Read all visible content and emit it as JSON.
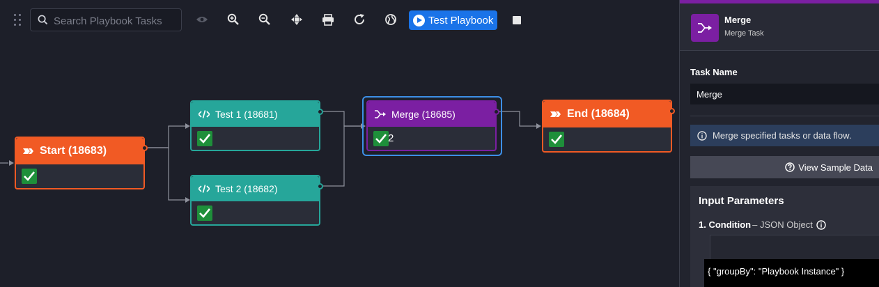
{
  "toolbar": {
    "search_placeholder": "Search Playbook Tasks",
    "icons": [
      "drag-handle-icon",
      "eye-icon",
      "zoom-in-icon",
      "zoom-out-icon",
      "fit-to-screen-icon",
      "print-icon",
      "refresh-icon",
      "globe-icon",
      "stop-icon"
    ],
    "test_button_label": "Test Playbook"
  },
  "nodes": {
    "start": {
      "title": "Start (18683)",
      "color": "#f15a24"
    },
    "test1": {
      "title": "Test 1 (18681)",
      "color": "#26a69a"
    },
    "test2": {
      "title": "Test 2 (18682)",
      "color": "#26a69a"
    },
    "merge": {
      "title": "Merge (18685)",
      "color": "#7b1fa2",
      "count": "2"
    },
    "end": {
      "title": "End (18684)",
      "color": "#f15a24"
    }
  },
  "panel": {
    "title": "Merge",
    "subtitle": "Merge Task",
    "task_name_label": "Task Name",
    "task_name_value": "Merge",
    "info_text": "Merge specified tasks or data flow.",
    "view_sample_label": "View Sample Data",
    "input_params_title": "Input Parameters",
    "condition_label": "1. Condition",
    "condition_type": "– JSON Object",
    "condition_value": "{ \"groupBy\": \"Playbook Instance\" }"
  },
  "colors": {
    "accent_purple": "#7b1fa2",
    "accent_blue": "#1a73e8",
    "success": "#1e8f3a"
  }
}
